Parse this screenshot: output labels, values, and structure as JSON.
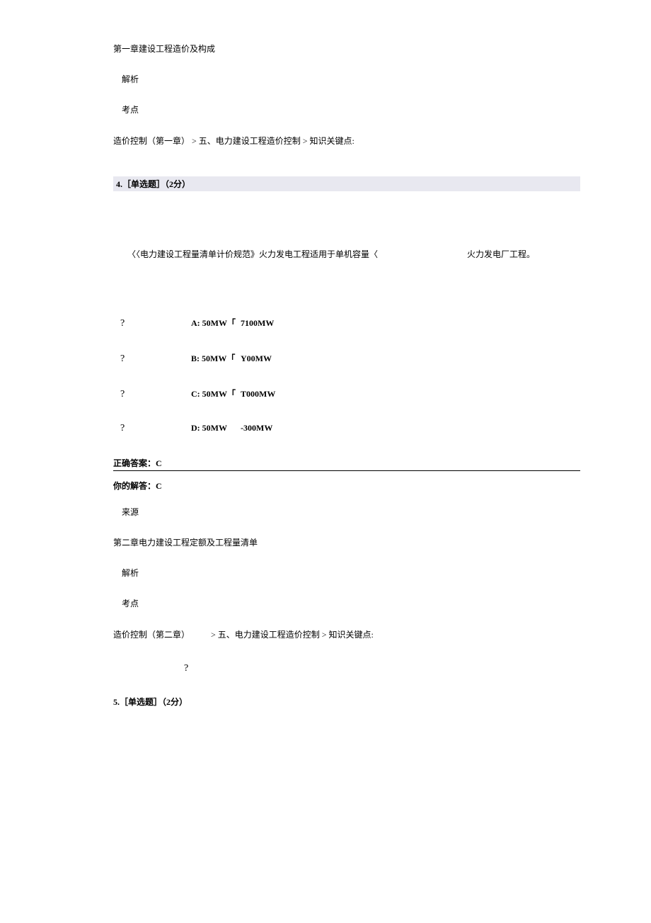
{
  "prev": {
    "source_chapter": "第一章建设工程造价及构成",
    "analysis_label": "解析",
    "point_label": "考点",
    "point_path": "造价控制（第一章） > 五、电力建设工程造价控制 > 知识关键点:"
  },
  "q4": {
    "header": "4.［单选题］（2分）",
    "stem_prefix": "〈〈电力建设工程量清单计价规范》火力发电工程适用于单机容量〈",
    "stem_suffix": "火力发电厂工程。",
    "options": [
      {
        "q": "?",
        "label": "A: 50MW「",
        "value": "7100MW"
      },
      {
        "q": "?",
        "label": "B: 50MW「",
        "value": "Y00MW"
      },
      {
        "q": "?",
        "label": "C: 50MW「",
        "value": "T000MW"
      },
      {
        "q": "?",
        "label": "D: 50MW",
        "value": "-300MW"
      }
    ],
    "correct_label": "正确答案：C",
    "your_label": "你的解答：C",
    "source_label": "来源",
    "source_chapter": "第二章电力建设工程定额及工程量清单",
    "analysis_label": "解析",
    "point_label": "考点",
    "point_path_a": "造价控制（第二章）",
    "point_path_b": "> 五、电力建设工程造价控制 > 知识关键点:",
    "note_mark": "?"
  },
  "q5": {
    "header": "5.［单选题］（2分）"
  }
}
